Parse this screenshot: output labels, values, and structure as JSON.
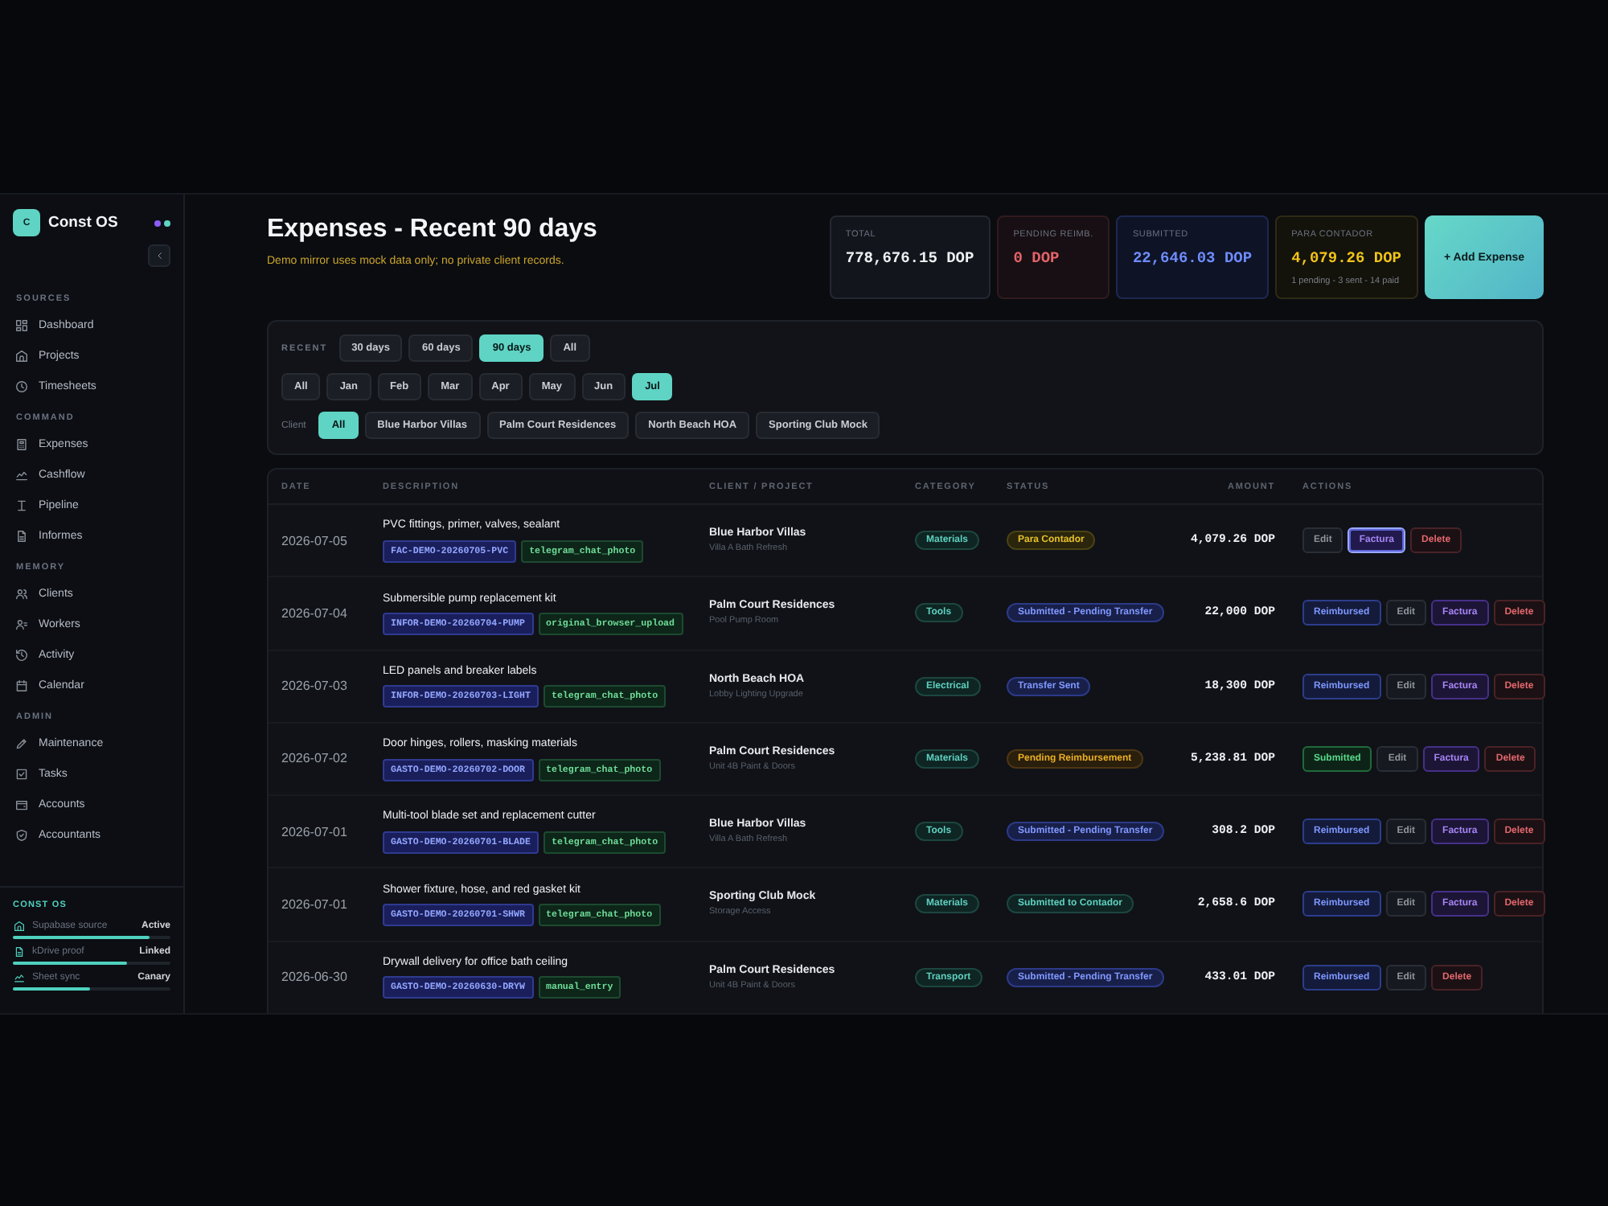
{
  "sidebar": {
    "brand": {
      "logo": "C",
      "name": "Const OS"
    },
    "sections": [
      {
        "title": "SOURCES",
        "items": [
          {
            "label": "Dashboard"
          },
          {
            "label": "Projects"
          },
          {
            "label": "Timesheets"
          }
        ]
      },
      {
        "title": "COMMAND",
        "items": [
          {
            "label": "Expenses"
          },
          {
            "label": "Cashflow"
          },
          {
            "label": "Pipeline"
          },
          {
            "label": "Informes"
          }
        ]
      },
      {
        "title": "MEMORY",
        "items": [
          {
            "label": "Clients"
          },
          {
            "label": "Workers"
          },
          {
            "label": "Activity"
          },
          {
            "label": "Calendar"
          }
        ]
      },
      {
        "title": "ADMIN",
        "items": [
          {
            "label": "Maintenance"
          },
          {
            "label": "Tasks"
          },
          {
            "label": "Accounts"
          },
          {
            "label": "Accountants"
          }
        ]
      }
    ],
    "status_panel": {
      "title": "CONST OS",
      "rows": [
        {
          "label": "Supabase source",
          "value": "Active",
          "level": 0.87
        },
        {
          "label": "kDrive proof",
          "value": "Linked",
          "level": 0.72
        },
        {
          "label": "Sheet sync",
          "value": "Canary",
          "level": 0.49
        }
      ]
    }
  },
  "header": {
    "title": "Expenses - Recent 90 days",
    "subtitle": "Demo mirror uses mock data only; no private client records."
  },
  "stats": [
    {
      "kind": "total",
      "label": "TOTAL",
      "value": "778,676.15 DOP"
    },
    {
      "kind": "pending",
      "label": "PENDING REIMB.",
      "value": "0 DOP"
    },
    {
      "kind": "submitted",
      "label": "SUBMITTED",
      "value": "22,646.03 DOP"
    },
    {
      "kind": "contador",
      "label": "PARA CONTADOR",
      "value": "4,079.26 DOP",
      "note": "1 pending - 3 sent - 14 paid"
    }
  ],
  "add_button": "+ Add Expense",
  "filters": {
    "recent": {
      "label": "RECENT",
      "options": [
        {
          "label": "30 days",
          "selected": false
        },
        {
          "label": "60 days",
          "selected": false
        },
        {
          "label": "90 days",
          "selected": true
        },
        {
          "label": "All",
          "selected": false
        }
      ]
    },
    "months": {
      "options": [
        {
          "label": "All",
          "selected": false
        },
        {
          "label": "Jan",
          "selected": false
        },
        {
          "label": "Feb",
          "selected": false
        },
        {
          "label": "Mar",
          "selected": false
        },
        {
          "label": "Apr",
          "selected": false
        },
        {
          "label": "May",
          "selected": false
        },
        {
          "label": "Jun",
          "selected": false
        },
        {
          "label": "Jul",
          "selected": true
        }
      ]
    },
    "client": {
      "label": "Client",
      "options": [
        {
          "label": "All",
          "selected": true
        },
        {
          "label": "Blue Harbor Villas",
          "selected": false
        },
        {
          "label": "Palm Court Residences",
          "selected": false
        },
        {
          "label": "North Beach HOA",
          "selected": false
        },
        {
          "label": "Sporting Club Mock",
          "selected": false
        }
      ]
    }
  },
  "table": {
    "columns": [
      "DATE",
      "DESCRIPTION",
      "CLIENT / PROJECT",
      "CATEGORY",
      "STATUS",
      "AMOUNT",
      "ACTIONS"
    ],
    "rows": [
      {
        "date": "2026-07-05",
        "description": "PVC fittings, primer, valves, sealant",
        "reference": "FAC-DEMO-20260705-PVC",
        "source": "telegram_chat_photo",
        "client": "Blue Harbor Villas",
        "project": "Villa A Bath Refresh",
        "category": "Materials",
        "status": {
          "label": "Para Contador",
          "kind": "contador"
        },
        "amount": "4,079.26 DOP",
        "actions": [
          {
            "label": "Edit",
            "kind": "edit",
            "focused": false
          },
          {
            "label": "Factura",
            "kind": "factura",
            "focused": true
          },
          {
            "label": "Delete",
            "kind": "delete",
            "focused": false
          }
        ]
      },
      {
        "date": "2026-07-04",
        "description": "Submersible pump replacement kit",
        "reference": "INFOR-DEMO-20260704-PUMP",
        "source": "original_browser_upload",
        "client": "Palm Court Residences",
        "project": "Pool Pump Room",
        "category": "Tools",
        "status": {
          "label": "Submitted - Pending Transfer",
          "kind": "transfer"
        },
        "amount": "22,000 DOP",
        "actions": [
          {
            "label": "Reimbursed",
            "kind": "reimburse",
            "focused": false
          },
          {
            "label": "Edit",
            "kind": "edit",
            "focused": false
          },
          {
            "label": "Factura",
            "kind": "factura",
            "focused": false
          },
          {
            "label": "Delete",
            "kind": "delete",
            "focused": false
          }
        ]
      },
      {
        "date": "2026-07-03",
        "description": "LED panels and breaker labels",
        "reference": "INFOR-DEMO-20260703-LIGHT",
        "source": "telegram_chat_photo",
        "client": "North Beach HOA",
        "project": "Lobby Lighting Upgrade",
        "category": "Electrical",
        "status": {
          "label": "Transfer Sent",
          "kind": "sent"
        },
        "amount": "18,300 DOP",
        "actions": [
          {
            "label": "Reimbursed",
            "kind": "reimburse",
            "focused": false
          },
          {
            "label": "Edit",
            "kind": "edit",
            "focused": false
          },
          {
            "label": "Factura",
            "kind": "factura",
            "focused": false
          },
          {
            "label": "Delete",
            "kind": "delete",
            "focused": false
          }
        ]
      },
      {
        "date": "2026-07-02",
        "description": "Door hinges, rollers, masking materials",
        "reference": "GASTO-DEMO-20260702-DOOR",
        "source": "telegram_chat_photo",
        "client": "Palm Court Residences",
        "project": "Unit 4B Paint & Doors",
        "category": "Materials",
        "status": {
          "label": "Pending Reimbursement",
          "kind": "reimbursement"
        },
        "amount": "5,238.81 DOP",
        "actions": [
          {
            "label": "Submitted",
            "kind": "submit",
            "focused": false
          },
          {
            "label": "Edit",
            "kind": "edit",
            "focused": false
          },
          {
            "label": "Factura",
            "kind": "factura",
            "focused": false
          },
          {
            "label": "Delete",
            "kind": "delete",
            "focused": false
          }
        ]
      },
      {
        "date": "2026-07-01",
        "description": "Multi-tool blade set and replacement cutter",
        "reference": "GASTO-DEMO-20260701-BLADE",
        "source": "telegram_chat_photo",
        "client": "Blue Harbor Villas",
        "project": "Villa A Bath Refresh",
        "category": "Tools",
        "status": {
          "label": "Submitted - Pending Transfer",
          "kind": "transfer"
        },
        "amount": "308.2 DOP",
        "actions": [
          {
            "label": "Reimbursed",
            "kind": "reimburse",
            "focused": false
          },
          {
            "label": "Edit",
            "kind": "edit",
            "focused": false
          },
          {
            "label": "Factura",
            "kind": "factura",
            "focused": false
          },
          {
            "label": "Delete",
            "kind": "delete",
            "focused": false
          }
        ]
      },
      {
        "date": "2026-07-01",
        "description": "Shower fixture, hose, and red gasket kit",
        "reference": "GASTO-DEMO-20260701-SHWR",
        "source": "telegram_chat_photo",
        "client": "Sporting Club Mock",
        "project": "Storage Access",
        "category": "Materials",
        "status": {
          "label": "Submitted to Contador",
          "kind": "filed"
        },
        "amount": "2,658.6 DOP",
        "actions": [
          {
            "label": "Reimbursed",
            "kind": "reimburse",
            "focused": false
          },
          {
            "label": "Edit",
            "kind": "edit",
            "focused": false
          },
          {
            "label": "Factura",
            "kind": "factura",
            "focused": false
          },
          {
            "label": "Delete",
            "kind": "delete",
            "focused": false
          }
        ]
      },
      {
        "date": "2026-06-30",
        "description": "Drywall delivery for office bath ceiling",
        "reference": "GASTO-DEMO-20260630-DRYW",
        "source": "manual_entry",
        "client": "Palm Court Residences",
        "project": "Unit 4B Paint & Doors",
        "category": "Transport",
        "status": {
          "label": "Submitted - Pending Transfer",
          "kind": "transfer"
        },
        "amount": "433.01 DOP",
        "actions": [
          {
            "label": "Reimbursed",
            "kind": "reimburse",
            "focused": false
          },
          {
            "label": "Edit",
            "kind": "edit",
            "focused": false
          },
          {
            "label": "Delete",
            "kind": "delete",
            "focused": false
          }
        ]
      }
    ]
  }
}
